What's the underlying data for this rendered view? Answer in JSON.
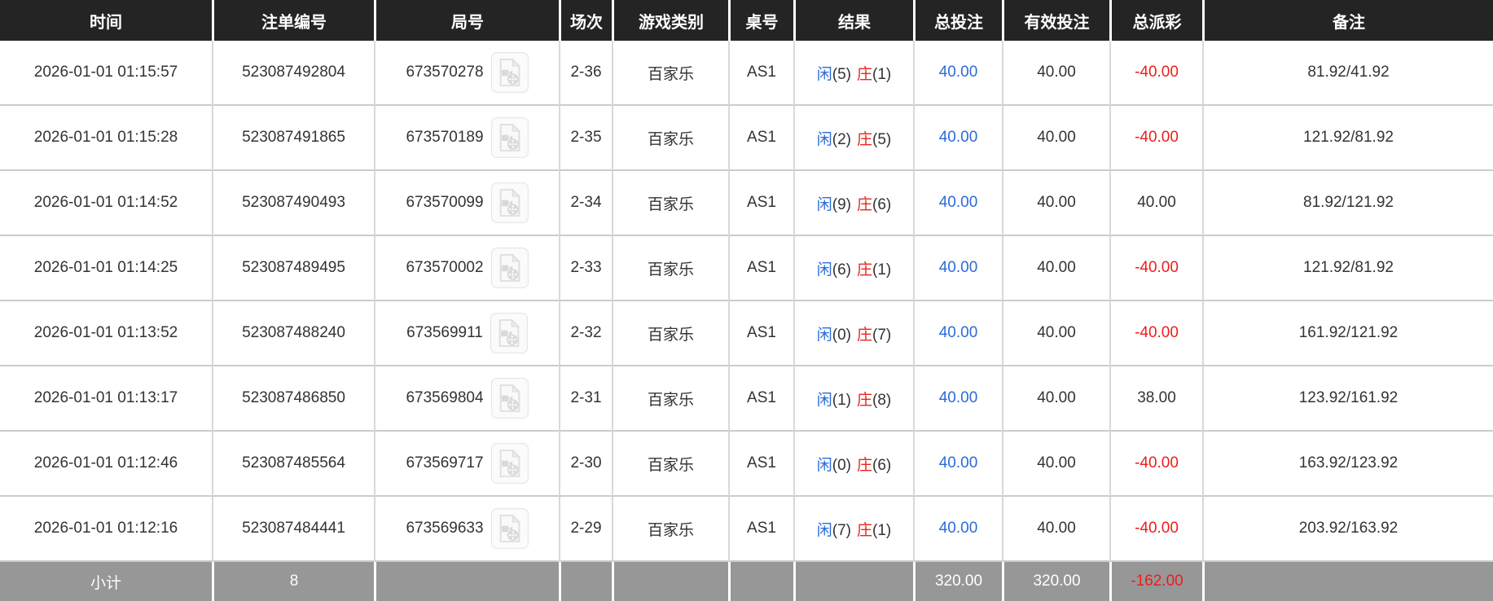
{
  "colors": {
    "header_bg": "#242424",
    "footer_bg": "#979797",
    "player_blue": "#2b6bd8",
    "banker_red": "#e8251d",
    "negative_red": "#ee1c1c"
  },
  "icons": {
    "video_icon": "video-file-icon"
  },
  "table": {
    "columns": [
      {
        "key": "time",
        "label": "时间"
      },
      {
        "key": "order-id",
        "label": "注单编号"
      },
      {
        "key": "round-id",
        "label": "局号"
      },
      {
        "key": "session",
        "label": "场次"
      },
      {
        "key": "game-type",
        "label": "游戏类别"
      },
      {
        "key": "table-id",
        "label": "桌号"
      },
      {
        "key": "result",
        "label": "结果"
      },
      {
        "key": "total-bet",
        "label": "总投注"
      },
      {
        "key": "valid-bet",
        "label": "有效投注"
      },
      {
        "key": "payout",
        "label": "总派彩"
      },
      {
        "key": "remark",
        "label": "备注"
      }
    ],
    "rows": [
      {
        "time": "2026-01-01 01:15:57",
        "order_no": "523087492804",
        "round_no": "673570278",
        "session": "2-36",
        "game_type": "百家乐",
        "table_no": "AS1",
        "result_player_label": "闲",
        "result_player_num": "(5)",
        "result_banker_label": "庄",
        "result_banker_num": "(1)",
        "total_bet": "40.00",
        "valid_bet": "40.00",
        "payout": "-40.00",
        "remark": "81.92/41.92"
      },
      {
        "time": "2026-01-01 01:15:28",
        "order_no": "523087491865",
        "round_no": "673570189",
        "session": "2-35",
        "game_type": "百家乐",
        "table_no": "AS1",
        "result_player_label": "闲",
        "result_player_num": "(2)",
        "result_banker_label": "庄",
        "result_banker_num": "(5)",
        "total_bet": "40.00",
        "valid_bet": "40.00",
        "payout": "-40.00",
        "remark": "121.92/81.92"
      },
      {
        "time": "2026-01-01 01:14:52",
        "order_no": "523087490493",
        "round_no": "673570099",
        "session": "2-34",
        "game_type": "百家乐",
        "table_no": "AS1",
        "result_player_label": "闲",
        "result_player_num": "(9)",
        "result_banker_label": "庄",
        "result_banker_num": "(6)",
        "total_bet": "40.00",
        "valid_bet": "40.00",
        "payout": "40.00",
        "remark": "81.92/121.92"
      },
      {
        "time": "2026-01-01 01:14:25",
        "order_no": "523087489495",
        "round_no": "673570002",
        "session": "2-33",
        "game_type": "百家乐",
        "table_no": "AS1",
        "result_player_label": "闲",
        "result_player_num": "(6)",
        "result_banker_label": "庄",
        "result_banker_num": "(1)",
        "total_bet": "40.00",
        "valid_bet": "40.00",
        "payout": "-40.00",
        "remark": "121.92/81.92"
      },
      {
        "time": "2026-01-01 01:13:52",
        "order_no": "523087488240",
        "round_no": "673569911",
        "session": "2-32",
        "game_type": "百家乐",
        "table_no": "AS1",
        "result_player_label": "闲",
        "result_player_num": "(0)",
        "result_banker_label": "庄",
        "result_banker_num": "(7)",
        "total_bet": "40.00",
        "valid_bet": "40.00",
        "payout": "-40.00",
        "remark": "161.92/121.92"
      },
      {
        "time": "2026-01-01 01:13:17",
        "order_no": "523087486850",
        "round_no": "673569804",
        "session": "2-31",
        "game_type": "百家乐",
        "table_no": "AS1",
        "result_player_label": "闲",
        "result_player_num": "(1)",
        "result_banker_label": "庄",
        "result_banker_num": "(8)",
        "total_bet": "40.00",
        "valid_bet": "40.00",
        "payout": "38.00",
        "remark": "123.92/161.92"
      },
      {
        "time": "2026-01-01 01:12:46",
        "order_no": "523087485564",
        "round_no": "673569717",
        "session": "2-30",
        "game_type": "百家乐",
        "table_no": "AS1",
        "result_player_label": "闲",
        "result_player_num": "(0)",
        "result_banker_label": "庄",
        "result_banker_num": "(6)",
        "total_bet": "40.00",
        "valid_bet": "40.00",
        "payout": "-40.00",
        "remark": "163.92/123.92"
      },
      {
        "time": "2026-01-01 01:12:16",
        "order_no": "523087484441",
        "round_no": "673569633",
        "session": "2-29",
        "game_type": "百家乐",
        "table_no": "AS1",
        "result_player_label": "闲",
        "result_player_num": "(7)",
        "result_banker_label": "庄",
        "result_banker_num": "(1)",
        "total_bet": "40.00",
        "valid_bet": "40.00",
        "payout": "-40.00",
        "remark": "203.92/163.92"
      }
    ],
    "footer": {
      "label": "小计",
      "count": "8",
      "total_bet": "320.00",
      "valid_bet": "320.00",
      "payout": "-162.00"
    }
  }
}
